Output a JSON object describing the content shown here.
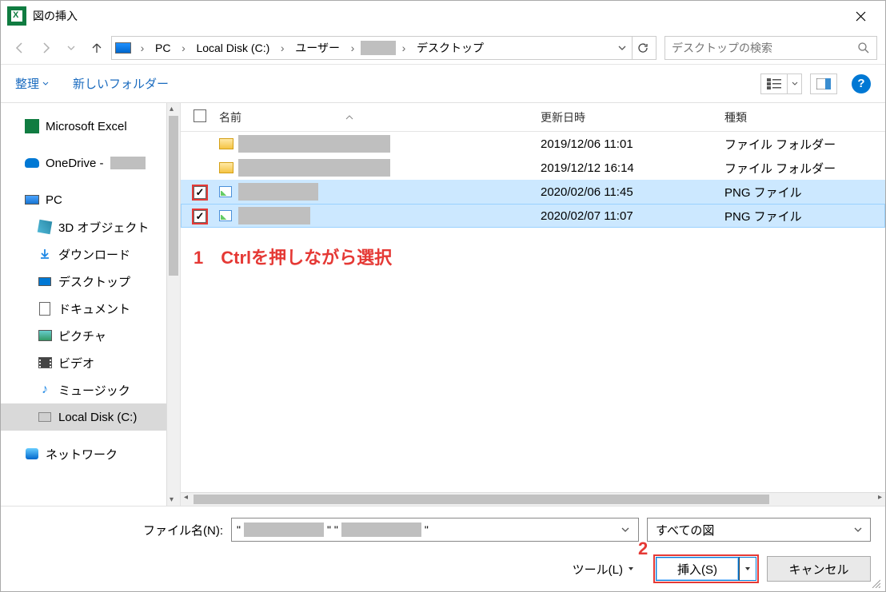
{
  "titlebar": {
    "title": "図の挿入"
  },
  "breadcrumb": {
    "segments": [
      "PC",
      "Local Disk (C:)",
      "ユーザー",
      "",
      "デスクトップ"
    ]
  },
  "search": {
    "placeholder": "デスクトップの検索"
  },
  "toolbar": {
    "organize": "整理",
    "new_folder": "新しいフォルダー",
    "help": "?"
  },
  "sidebar": {
    "items": [
      {
        "label": "Microsoft Excel"
      },
      {
        "label": "OneDrive - "
      },
      {
        "label": "PC"
      },
      {
        "label": "3D オブジェクト"
      },
      {
        "label": "ダウンロード"
      },
      {
        "label": "デスクトップ"
      },
      {
        "label": "ドキュメント"
      },
      {
        "label": "ピクチャ"
      },
      {
        "label": "ビデオ"
      },
      {
        "label": "ミュージック"
      },
      {
        "label": "Local Disk (C:)"
      },
      {
        "label": "ネットワーク"
      }
    ]
  },
  "columns": {
    "name": "名前",
    "date": "更新日時",
    "type": "種類"
  },
  "rows": [
    {
      "date": "2019/12/06 11:01",
      "type": "ファイル フォルダー"
    },
    {
      "date": "2019/12/12 16:14",
      "type": "ファイル フォルダー"
    },
    {
      "date": "2020/02/06 11:45",
      "type": "PNG ファイル"
    },
    {
      "date": "2020/02/07 11:07",
      "type": "PNG ファイル"
    }
  ],
  "annotations": {
    "a1": "1　Ctrlを押しながら選択",
    "a2": "2"
  },
  "footer": {
    "filename_label": "ファイル名(N):",
    "filter": "すべての図",
    "tools": "ツール(L)",
    "insert": "挿入(S)",
    "cancel": "キャンセル"
  }
}
